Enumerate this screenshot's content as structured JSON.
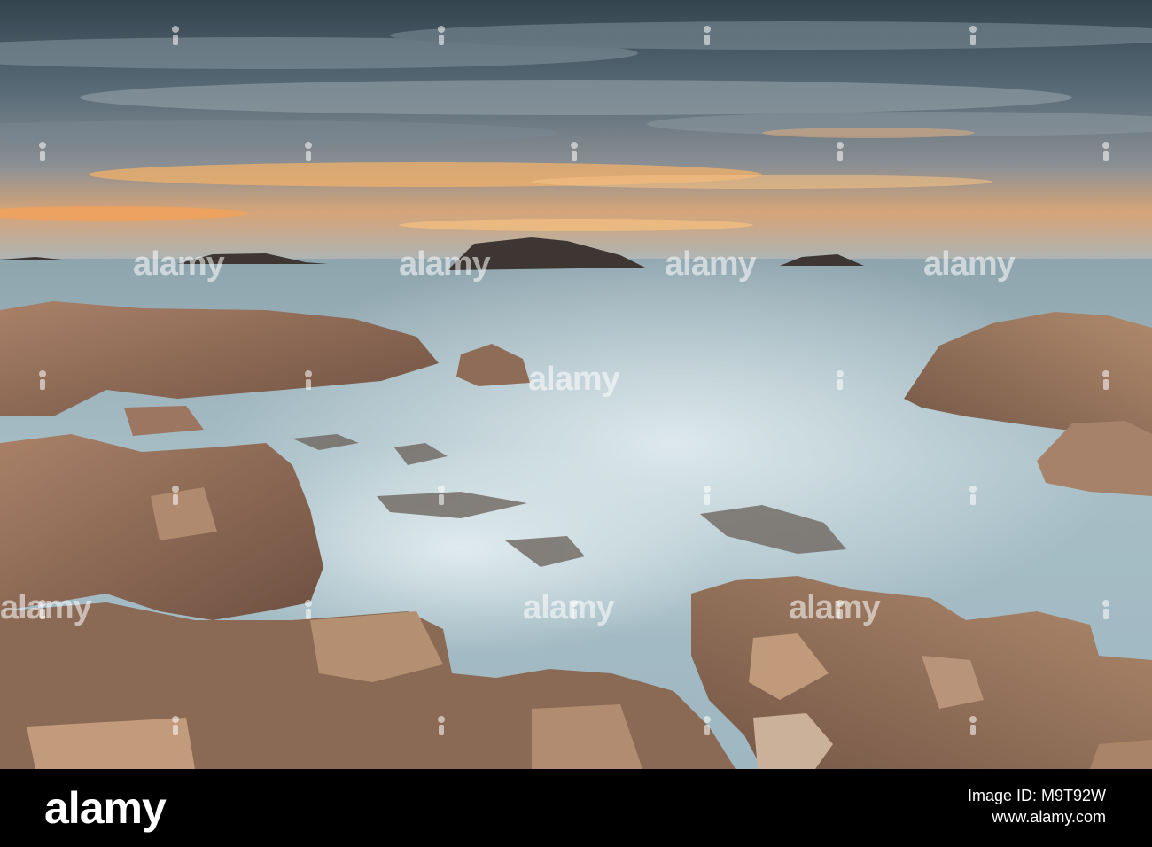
{
  "photo": {
    "subject": "rocky coastline at sunset with misty long-exposure sea",
    "colors": {
      "sky_top": "#3b4c5a",
      "sky_glow": "#f2a45c",
      "sea": "#a9c0c8",
      "rock": "#9a7560"
    }
  },
  "watermark": {
    "word": "alamy"
  },
  "footer": {
    "brand": "alamy",
    "line1": "Image ID: M9T92W",
    "line2": "www.alamy.com"
  }
}
